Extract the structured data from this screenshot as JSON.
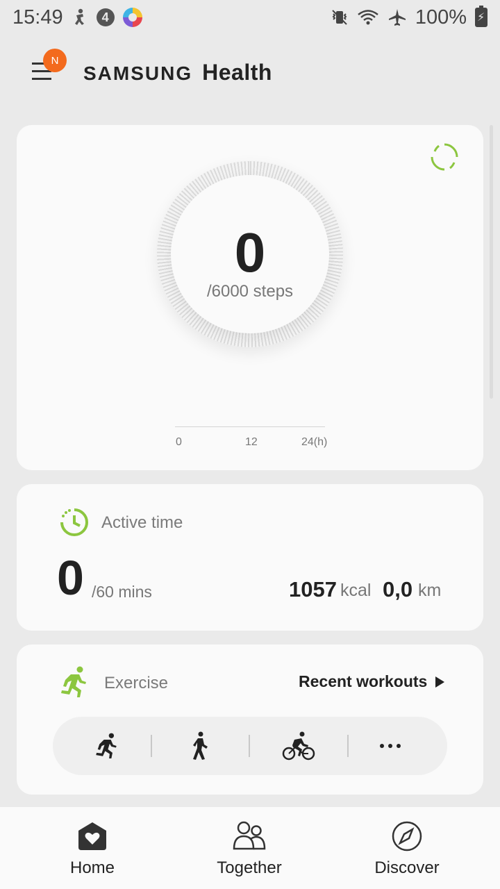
{
  "status_bar": {
    "time": "15:49",
    "battery": "100%",
    "left_icons": [
      "accessibility-icon",
      "four-badge-icon",
      "colorful-app-icon"
    ],
    "right_icons": [
      "vibrate-icon",
      "wifi-icon",
      "airplane-icon",
      "battery-charging-icon"
    ]
  },
  "header": {
    "menu_badge": "N",
    "brand_samsung": "SAMSUNG",
    "brand_health": "Health"
  },
  "steps": {
    "value": "0",
    "goal": "/6000 steps",
    "ticks": [
      "0",
      "12",
      "24(h)"
    ],
    "progress_fraction": 0
  },
  "active_time": {
    "title": "Active time",
    "value": "0",
    "goal": "/60 mins",
    "kcal_value": "1057",
    "kcal_unit": "kcal",
    "km_value": "0,0",
    "km_unit": "km"
  },
  "exercise": {
    "title": "Exercise",
    "recent_label": "Recent workouts",
    "workouts": [
      "running-icon",
      "walking-icon",
      "cycling-icon",
      "more-icon"
    ]
  },
  "bottom_nav": {
    "items": [
      {
        "label": "Home",
        "icon": "home-heart-icon"
      },
      {
        "label": "Together",
        "icon": "people-icon"
      },
      {
        "label": "Discover",
        "icon": "compass-icon"
      }
    ]
  },
  "colors": {
    "accent_green": "#8cc63f",
    "badge_orange": "#f36a1d",
    "background": "#eaeaea",
    "card": "#fafafa"
  }
}
